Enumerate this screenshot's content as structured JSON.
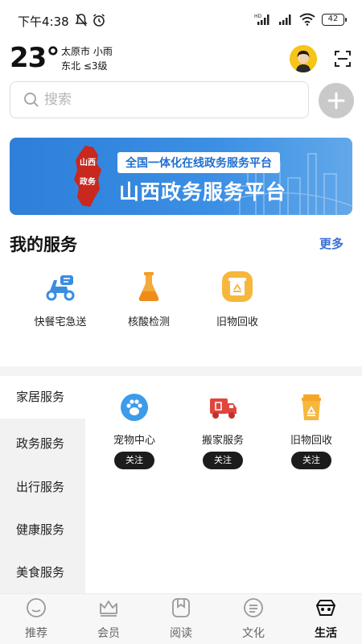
{
  "status_bar": {
    "time": "下午4:38",
    "network_label": "HD",
    "battery": "42"
  },
  "weather": {
    "temperature": "23°",
    "city": "太原市",
    "condition": "小雨",
    "wind_direction": "东北",
    "wind_level": "≤3级"
  },
  "search": {
    "placeholder": "搜索"
  },
  "banner": {
    "tagline": "全国一体化在线政务服务平台",
    "title": "山西政务服务平台",
    "map_text": "山西政务"
  },
  "my_services": {
    "title": "我的服务",
    "more": "更多",
    "items": [
      {
        "label": "快餐宅急送",
        "icon": "delivery-scooter-icon"
      },
      {
        "label": "核酸检测",
        "icon": "test-tube-icon"
      },
      {
        "label": "旧物回收",
        "icon": "recycle-icon"
      }
    ]
  },
  "categories": {
    "items": [
      {
        "label": "家居服务"
      },
      {
        "label": "政务服务"
      },
      {
        "label": "出行服务"
      },
      {
        "label": "健康服务"
      },
      {
        "label": "美食服务"
      }
    ],
    "active_index": 0,
    "cards": [
      {
        "label": "宠物中心",
        "button": "关注",
        "icon": "paw-icon"
      },
      {
        "label": "搬家服务",
        "button": "关注",
        "icon": "moving-truck-icon"
      },
      {
        "label": "旧物回收",
        "button": "关注",
        "icon": "recycle-bin-icon"
      }
    ]
  },
  "bottom_nav": {
    "items": [
      {
        "label": "推荐",
        "icon": "recommend-icon"
      },
      {
        "label": "会员",
        "icon": "crown-icon"
      },
      {
        "label": "阅读",
        "icon": "book-icon"
      },
      {
        "label": "文化",
        "icon": "culture-icon"
      },
      {
        "label": "生活",
        "icon": "life-icon"
      }
    ],
    "active_index": 4
  },
  "colors": {
    "accent_blue": "#3a6fd8",
    "banner_blue": "#2d7fd8",
    "map_red": "#c8281e",
    "avatar_yellow": "#f5c518"
  }
}
